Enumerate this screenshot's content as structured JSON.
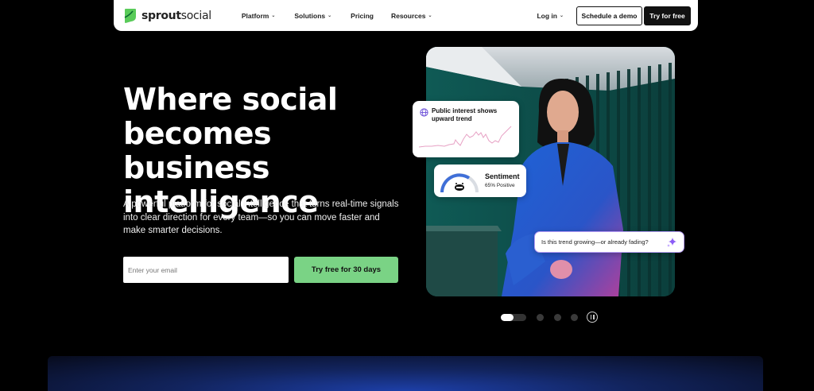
{
  "nav": {
    "brand_bold": "sprout",
    "brand_light": "social",
    "links": [
      {
        "label": "Platform",
        "dropdown": true
      },
      {
        "label": "Solutions",
        "dropdown": true
      },
      {
        "label": "Pricing",
        "dropdown": false
      },
      {
        "label": "Resources",
        "dropdown": true
      }
    ],
    "login_label": "Log in",
    "demo_label": "Schedule a demo",
    "try_label": "Try for free"
  },
  "hero": {
    "title": "Where social becomes business intelligence",
    "subtitle": "A powerful platform for social intelligence that turns real-time signals into clear direction for every team—so you can move faster and make smarter decisions.",
    "email_placeholder": "Enter your email",
    "cta_label": "Try free for 30 days"
  },
  "cards": {
    "trend_text": "Public interest shows upward trend",
    "sentiment_label": "Sentiment",
    "sentiment_value": "65% Positive",
    "sentiment_fraction": 0.65,
    "question": "Is this trend growing—or already fading?"
  },
  "carousel": {
    "slide_count": 4,
    "active_index": 0
  },
  "colors": {
    "brand_green": "#59cb59",
    "cta_green": "#7ad385",
    "accent_purple": "#8b5cf6",
    "trend_line": "#e7a1c4"
  },
  "icons": [
    "sprout-logo-icon",
    "chevron-down-icon",
    "globe-icon",
    "smile-icon",
    "sparkle-icon",
    "pause-icon"
  ]
}
